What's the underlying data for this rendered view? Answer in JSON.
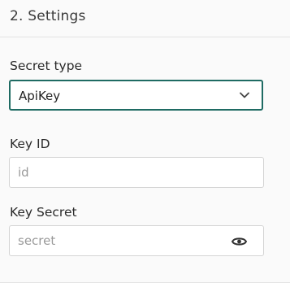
{
  "section": {
    "title": "2. Settings"
  },
  "fields": {
    "secret_type": {
      "label": "Secret type",
      "value": "ApiKey",
      "icon": "chevron-down-icon"
    },
    "key_id": {
      "label": "Key ID",
      "placeholder": "id"
    },
    "key_secret": {
      "label": "Key Secret",
      "placeholder": "secret",
      "icon": "eye-icon"
    }
  },
  "colors": {
    "focus_border": "#1f6b63",
    "input_border": "#d4d4d4",
    "placeholder": "#9a9a9a",
    "background": "#fafafa"
  }
}
